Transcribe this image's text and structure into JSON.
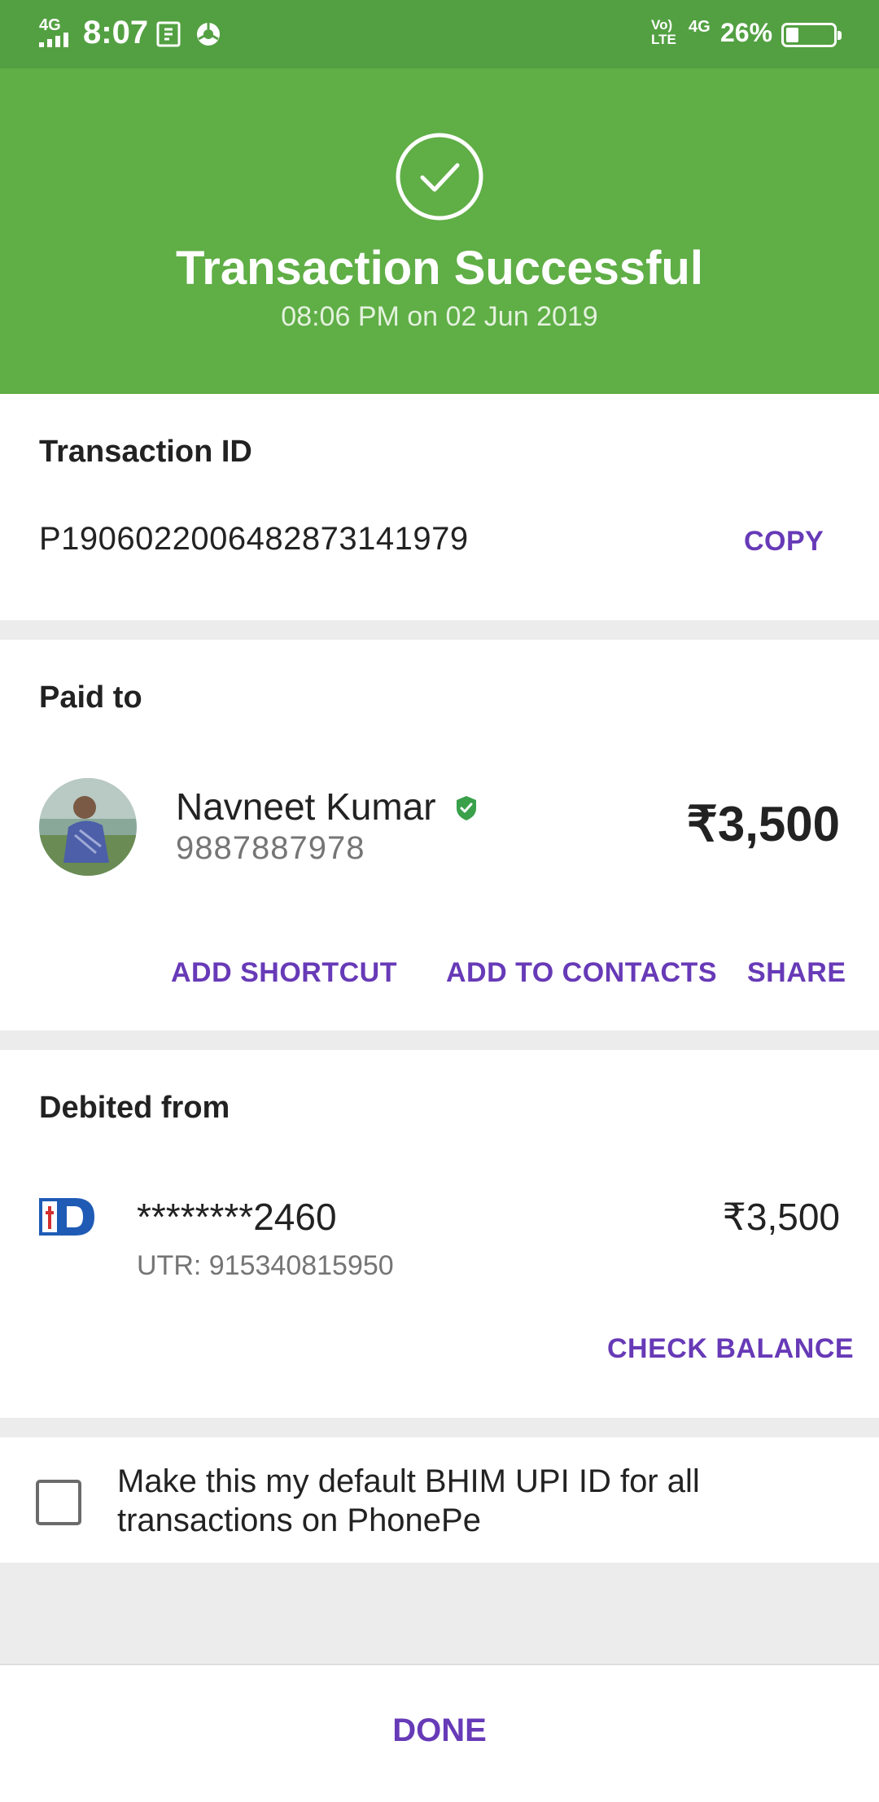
{
  "status_bar": {
    "network_left": "4G",
    "time": "8:07",
    "icons_left": [
      "screenshot-icon",
      "chrome-icon"
    ],
    "volte_label": "Vo) LTE",
    "network_right": "4G",
    "battery_percent": "26%",
    "battery_level": 0.26
  },
  "header": {
    "title": "Transaction Successful",
    "datetime": "08:06 PM on 02 Jun 2019",
    "background_color": "#5fae46"
  },
  "transaction": {
    "label": "Transaction ID",
    "id": "P1906022006482873141979",
    "copy_label": "COPY"
  },
  "paid_to": {
    "label": "Paid to",
    "name": "Navneet Kumar",
    "phone": "9887887978",
    "amount": "₹3,500",
    "verified_icon": "verified-badge-icon",
    "actions": {
      "add_shortcut": "ADD SHORTCUT",
      "add_to_contacts": "ADD TO CONTACTS",
      "share": "SHARE"
    }
  },
  "debited_from": {
    "label": "Debited from",
    "account": "********2460",
    "utr": "UTR: 915340815950",
    "amount": "₹3,500",
    "bank_icon": "bank-logo-icon",
    "check_balance_label": "CHECK BALANCE"
  },
  "default_upi": {
    "checked": false,
    "text": "Make this my default BHIM UPI ID for all transactions on PhonePe"
  },
  "footer": {
    "done_label": "DONE"
  },
  "colors": {
    "accent": "#673ab7",
    "status_bar": "#53a042",
    "header": "#5fae46",
    "verified": "#3aa04a"
  }
}
